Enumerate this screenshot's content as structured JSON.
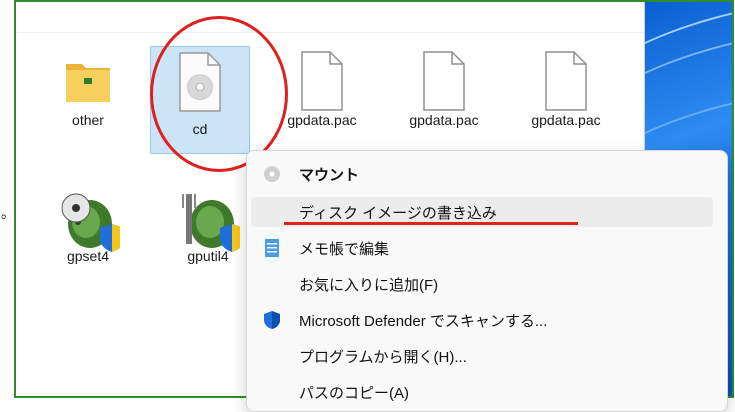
{
  "stray_char": "。",
  "files": [
    {
      "label": "other",
      "icon": "folder-icon"
    },
    {
      "label": "cd",
      "icon": "disc-image-file-icon",
      "selected": true
    },
    {
      "label": "gpdata.pac",
      "icon": "blank-file-icon"
    },
    {
      "label": "gpdata.pac",
      "icon": "blank-file-icon"
    },
    {
      "label": "gpdata.pac",
      "icon": "blank-file-icon"
    },
    {
      "label": "gpset4",
      "icon": "app-disc-shield-icon"
    },
    {
      "label": "gputil4",
      "icon": "app-fork-shield-icon"
    }
  ],
  "context_menu": {
    "items": [
      {
        "label": "マウント",
        "icon": "disc-icon",
        "bold": true
      },
      {
        "label": "ディスク イメージの書き込み",
        "icon": "none",
        "highlighted": true
      },
      {
        "label": "メモ帳で編集",
        "icon": "notepad-icon"
      },
      {
        "label": "お気に入りに追加(F)",
        "icon": "none"
      },
      {
        "label": "Microsoft Defender でスキャンする...",
        "icon": "defender-shield-icon"
      },
      {
        "label": "プログラムから開く(H)...",
        "icon": "none"
      },
      {
        "label": "パスのコピー(A)",
        "icon": "none"
      }
    ]
  },
  "colors": {
    "annotation_red": "#e01f1f",
    "frame_green": "#2e8b2e",
    "selection_bg": "#cce4f7",
    "wallpaper_blue": "#1a6ee0"
  }
}
